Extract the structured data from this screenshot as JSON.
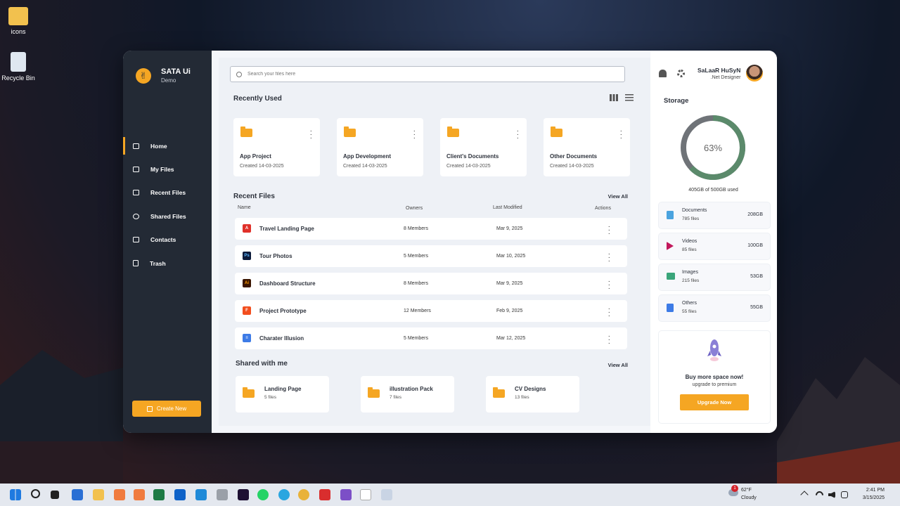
{
  "desktop": {
    "icons": [
      {
        "label": "icons"
      },
      {
        "label": "Recycle Bin"
      }
    ]
  },
  "app": {
    "brand": {
      "title": "SATA Ui",
      "subtitle": "Demo"
    },
    "nav": [
      {
        "label": "Home",
        "active": true
      },
      {
        "label": "My Files"
      },
      {
        "label": "Recent Files"
      },
      {
        "label": "Shared Files"
      },
      {
        "label": "Contacts"
      },
      {
        "label": "Trash"
      }
    ],
    "create_button": "Create New",
    "search": {
      "placeholder": "Search your files here"
    },
    "recently_used": {
      "title": "Recently Used",
      "folders": [
        {
          "name": "App Project",
          "created": "Created 14-03-2025"
        },
        {
          "name": "App Development",
          "created": "Created 14-03-2025"
        },
        {
          "name": "Client's Documents",
          "created": "Created 14-03-2025"
        },
        {
          "name": "Other Documents",
          "created": "Created 14-03-2025"
        }
      ]
    },
    "recent_files": {
      "title": "Recent Files",
      "view_all": "View All",
      "columns": [
        "Name",
        "Owners",
        "Last Modified",
        "Actions"
      ],
      "rows": [
        {
          "name": "Travel Landing Page",
          "owners": "8 Members",
          "modified": "Mar 9, 2025",
          "icon": "pdf-icon",
          "color": "#e0312a",
          "glyph": "A"
        },
        {
          "name": "Tour Photos",
          "owners": "5 Members",
          "modified": "Mar 10, 2025",
          "icon": "photoshop-icon",
          "color": "#0b1a3a",
          "glyph": "Ps"
        },
        {
          "name": "Dashboard Structure",
          "owners": "8 Members",
          "modified": "Mar 9, 2025",
          "icon": "illustrator-icon",
          "color": "#3a1500",
          "glyph": "Ai"
        },
        {
          "name": "Project Prototype",
          "owners": "12 Members",
          "modified": "Feb 9, 2025",
          "icon": "figma-icon",
          "color": "#f24e1e",
          "glyph": "F"
        },
        {
          "name": "Charater Illusion",
          "owners": "5 Members",
          "modified": "Mar 12, 2025",
          "icon": "document-icon",
          "color": "#3d7be6",
          "glyph": "≡"
        }
      ]
    },
    "shared": {
      "title": "Shared with me",
      "view_all": "View All",
      "items": [
        {
          "name": "Landing Page",
          "count": "5 files"
        },
        {
          "name": "illustration Pack",
          "count": "7 files"
        },
        {
          "name": "CV Designs",
          "count": "13 files"
        }
      ]
    },
    "user": {
      "name": "SaLaaR HuSyN",
      "role": ".Net Designer"
    },
    "storage": {
      "title": "Storage",
      "percent_label": "63%",
      "percent": 63,
      "used_text": "405GB of 500GB used",
      "categories": [
        {
          "name": "Documents",
          "count": "785 files",
          "size": "208GB",
          "icon": "documents-icon",
          "color": "#4aa3df"
        },
        {
          "name": "Videos",
          "count": "85 files",
          "size": "100GB",
          "icon": "video-icon",
          "color": "#c2185b"
        },
        {
          "name": "Images",
          "count": "215 files",
          "size": "53GB",
          "icon": "image-icon",
          "color": "#3aa57a"
        },
        {
          "name": "Others",
          "count": "55 files",
          "size": "55GB",
          "icon": "file-icon",
          "color": "#3d7be6"
        }
      ],
      "ring_color": "#5b8a6b",
      "ring_track": "#6f7378"
    },
    "promo": {
      "title": "Buy more space now!",
      "subtitle": "upgrade to premium",
      "button": "Upgrade Now"
    },
    "accent": "#f5a623"
  },
  "taskbar": {
    "weather": {
      "temp": "62°F",
      "condition": "Cloudy",
      "badge": "1"
    },
    "time": "2:41 PM",
    "date": "3/15/2025"
  }
}
